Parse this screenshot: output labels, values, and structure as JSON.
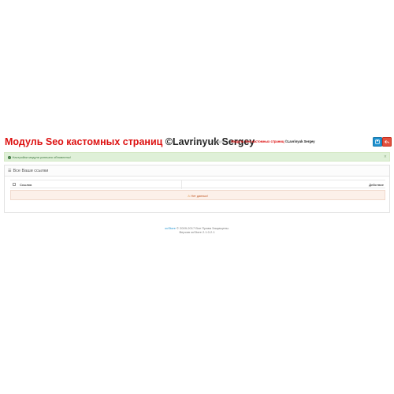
{
  "header": {
    "title_red": "Модуль Seo кастомных страниц",
    "title_black": " ©Lavrinyuk Sergey",
    "breadcrumb": {
      "home": "Главная",
      "separator": "»",
      "modules": "Модули",
      "module_name_red": "Модуль Seo кастомных страниц",
      "module_name_dark": " ©Lavrinyuk Sergey"
    },
    "save_icon": "save-icon",
    "cancel_icon": "reply-icon"
  },
  "alert": {
    "text": "Настройки модуля успешно обновлены!",
    "close": "×",
    "icon": "check-circle-icon"
  },
  "panel": {
    "title": "Все Ваши ссылки",
    "icon": "list-icon",
    "table": {
      "col_link": "Ссылка",
      "col_actions": "Действие",
      "empty_text": "Нет данных!",
      "empty_icon": "warning-icon"
    }
  },
  "footer": {
    "brand": "ocStore",
    "copyright": " © 2009-2017 Все Права Защищены.",
    "version": "Версия ocStore 2.1.0.2.1"
  },
  "colors": {
    "title_red": "#dd1111",
    "save_button": "#1e91cf",
    "cancel_button": "#e3503e",
    "alert_bg": "#dff0d8",
    "alert_text": "#3c763d",
    "empty_row_bg": "#fcf0e9"
  }
}
